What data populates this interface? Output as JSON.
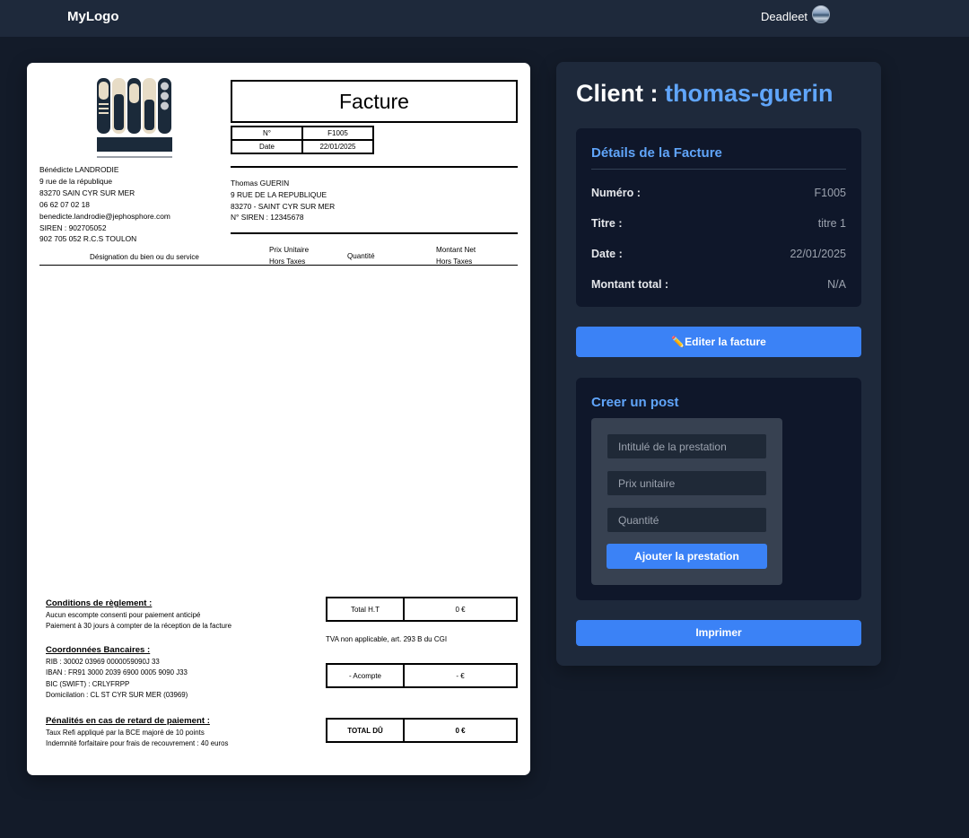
{
  "navbar": {
    "logo": "MyLogo",
    "username": "Deadleet"
  },
  "invoice": {
    "title": "Facture",
    "number_label": "N°",
    "number": "F1005",
    "date_label": "Date",
    "date": "22/01/2025",
    "seller_lines": [
      "Bénédicte LANDRODIE",
      "9 rue de la république",
      "83270 SAIN CYR SUR MER",
      "06 62 07 02 18",
      "benedicte.landrodie@jephosphore.com",
      "SIREN : 902705052",
      "902 705 052 R.C.S TOULON"
    ],
    "client_lines": [
      "Thomas GUERIN",
      "9 RUE DE LA REPUBLIQUE",
      "83270 - SAINT CYR SUR MER",
      "N° SIREN : 12345678"
    ],
    "columns": {
      "designation": "Désignation du bien ou du service",
      "unit_price_1": "Prix Unitaire",
      "unit_price_2": "Hors Taxes",
      "quantity": "Quantité",
      "net_1": "Montant Net",
      "net_2": "Hors Taxes"
    },
    "conditions": {
      "heading": "Conditions de règlement :",
      "line1": "Aucun escompte consenti pour paiement anticipé",
      "line2": "Paiement à 30 jours à compter de la réception de la facture"
    },
    "bank": {
      "heading": "Coordonnées Bancaires :",
      "rib": "RIB : 30002 03969 0000059090J 33",
      "iban": "IBAN : FR91 3000 2039 6900 0005 9090 J33",
      "bic": "BIC (SWIFT) : CRLYFRPP",
      "domiciliation": "Domicilation : CL ST CYR SUR MER (03969)"
    },
    "penalties": {
      "heading": "Pénalités en cas de retard de paiement :",
      "line1": "Taux Refi appliqué par la BCE majoré de 10 points",
      "line2": "Indemnité forfaitaire pour frais de recouvrement : 40 euros"
    },
    "totals": {
      "ht_label": "Total H.T",
      "ht_value": "0 €",
      "tva_note": "TVA non applicable, art. 293 B du CGI",
      "deposit_label": "- Acompte",
      "deposit_value": "- €",
      "due_label": "TOTAL DÛ",
      "due_value": "0 €"
    }
  },
  "panel": {
    "client_label": "Client :",
    "client_name": "thomas-guerin",
    "details": {
      "title": "Détails de la Facture",
      "rows": [
        {
          "label": "Numéro :",
          "value": "F1005"
        },
        {
          "label": "Titre :",
          "value": "titre 1"
        },
        {
          "label": "Date :",
          "value": "22/01/2025"
        },
        {
          "label": "Montant total :",
          "value": "N/A"
        }
      ]
    },
    "edit_button": "✏️Editer la facture",
    "post": {
      "title": "Creer un post",
      "title_placeholder": "Intitulé de la prestation",
      "price_placeholder": "Prix unitaire",
      "quantity_placeholder": "Quantité",
      "add_button": "Ajouter la prestation"
    },
    "print_button": "Imprimer"
  },
  "colors": {
    "accent": "#3b82f6",
    "accent_text": "#60a5fa",
    "page_bg": "#131b29",
    "panel_bg": "#1e293b",
    "card_bg": "#0f172a"
  }
}
